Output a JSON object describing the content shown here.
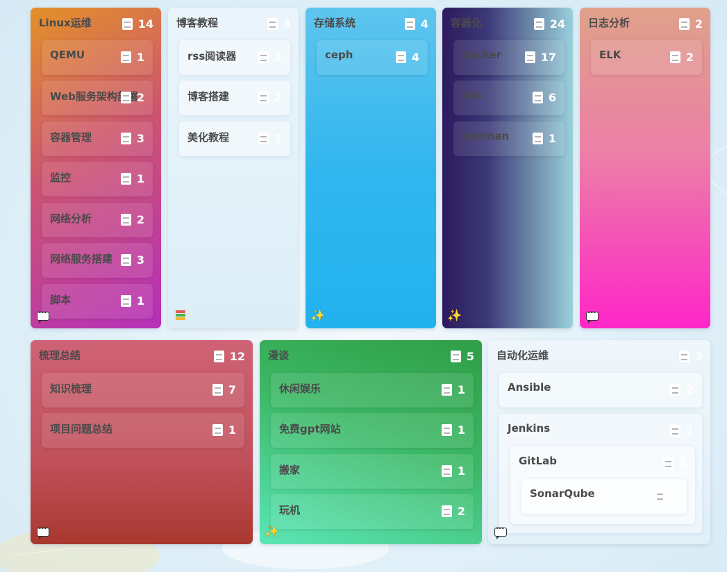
{
  "cards": {
    "linux": {
      "title": "Linux运维",
      "count": "14",
      "items": [
        {
          "label": "QEMU",
          "count": "1"
        },
        {
          "label": "Web服务架构部署",
          "count": "2"
        },
        {
          "label": "容器管理",
          "count": "3"
        },
        {
          "label": "监控",
          "count": "1"
        },
        {
          "label": "网络分析",
          "count": "2"
        },
        {
          "label": "网络服务搭建",
          "count": "3"
        },
        {
          "label": "脚本",
          "count": "1"
        }
      ]
    },
    "blog": {
      "title": "博客教程",
      "count": "4",
      "items": [
        {
          "label": "rss阅读器",
          "count": "1"
        },
        {
          "label": "博客搭建",
          "count": "2"
        },
        {
          "label": "美化教程",
          "count": "1"
        }
      ]
    },
    "storage": {
      "title": "存储系统",
      "count": "4",
      "items": [
        {
          "label": "ceph",
          "count": "4"
        }
      ]
    },
    "container": {
      "title": "容器化",
      "count": "24",
      "items": [
        {
          "label": "docker",
          "count": "17"
        },
        {
          "label": "k8s",
          "count": "6"
        },
        {
          "label": "podman",
          "count": "1"
        }
      ]
    },
    "logs": {
      "title": "日志分析",
      "count": "2",
      "items": [
        {
          "label": "ELK",
          "count": "2"
        }
      ]
    },
    "summary": {
      "title": "梳理总结",
      "count": "12",
      "items": [
        {
          "label": "知识梳理",
          "count": "7"
        },
        {
          "label": "项目问题总结",
          "count": "1"
        }
      ]
    },
    "talk": {
      "title": "漫谈",
      "count": "5",
      "items": [
        {
          "label": "休闲娱乐",
          "count": "1"
        },
        {
          "label": "免费gpt网站",
          "count": "1"
        },
        {
          "label": "搬家",
          "count": "1"
        },
        {
          "label": "玩机",
          "count": "2"
        }
      ]
    },
    "automation": {
      "title": "自动化运维",
      "count": "3",
      "items": {
        "ansible": {
          "label": "Ansible",
          "count": "2"
        },
        "jenkins": {
          "label": "Jenkins",
          "count": "1"
        },
        "gitlab": {
          "label": "GitLab",
          "count": "1"
        },
        "sonarqube": {
          "label": "SonarQube",
          "count": "1"
        }
      }
    }
  },
  "icons": {
    "item_count": "book-icon",
    "chat": "chat-bubble-icon",
    "sparkle": "sparkles-icon",
    "books": "books-icon"
  },
  "colors": {
    "linux": [
      "#e08f2c",
      "#b72db7"
    ],
    "blog": [
      "#eaf5fb",
      "#dcedf7"
    ],
    "storage": [
      "#5ec5ee",
      "#22b2ee"
    ],
    "container": [
      "#2c1a5e",
      "#9ad0dc"
    ],
    "logs": [
      "#dfa18a",
      "#ff26c8"
    ],
    "summary": [
      "#cf6375",
      "#a8382f"
    ],
    "talk": [
      "#2f9e46",
      "#5be6b7"
    ],
    "automation": [
      "#eef6fb",
      "#e1eff7"
    ]
  },
  "sparkle_glyph": "✨"
}
